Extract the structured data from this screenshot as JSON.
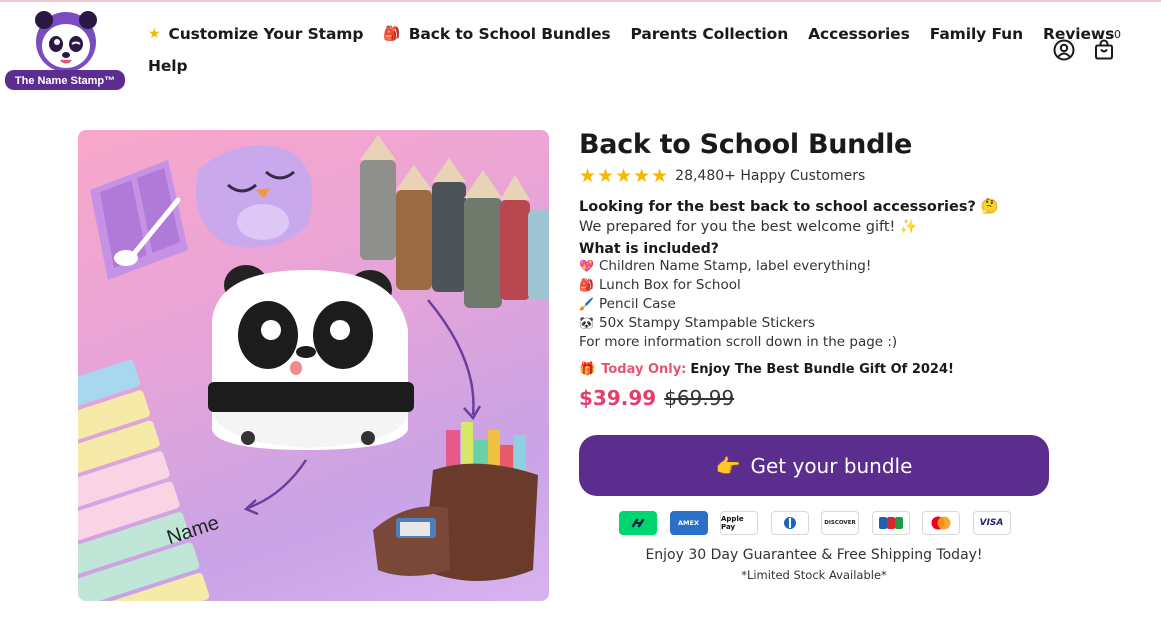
{
  "brand": {
    "logo_text": "The Name Stamp™"
  },
  "nav": {
    "items": [
      {
        "icon": "★",
        "icon_name": "star-icon",
        "label": "Customize Your Stamp"
      },
      {
        "icon": "🎒",
        "icon_name": "backpack-icon",
        "label": "Back to School Bundles"
      },
      {
        "label": "Parents Collection"
      },
      {
        "label": "Accessories"
      },
      {
        "label": "Family Fun"
      },
      {
        "label": "Reviews"
      }
    ],
    "help": "Help"
  },
  "header": {
    "cart_count": "0",
    "account_icon": "account-icon",
    "cart_icon": "shopping-bag-icon"
  },
  "product": {
    "title": "Back to School Bundle",
    "stars": "★★★★★",
    "rating_text": "28,480+ Happy Customers",
    "question": "Looking for the best back to school accessories? 🤔",
    "subtitle": "We prepared for you the best welcome gift! ✨",
    "included_title": "What is included?",
    "included": [
      {
        "emoji": "💖",
        "text": "Children Name Stamp, label everything!"
      },
      {
        "emoji": "🎒",
        "text": "Lunch Box for School"
      },
      {
        "emoji": "🖌️",
        "text": "Pencil Case"
      },
      {
        "emoji": "🐼",
        "text": "50x Stampy Stampable Stickers"
      }
    ],
    "more_info": "For more information scroll down in the page :)",
    "offer_emoji": "🎁",
    "offer_red": "Today Only:",
    "offer_text": "Enjoy The Best Bundle Gift Of 2024!",
    "price": "$39.99",
    "compare_price": "$69.99",
    "cta_emoji": "👉",
    "cta_label": "Get your bundle",
    "payments": [
      "Link",
      "AMEX",
      "Apple Pay",
      "Diners",
      "DISCOVER",
      "JCB",
      "Mastercard",
      "VISA"
    ],
    "guarantee": "Enjoy 30 Day Guarantee & Free Shipping Today!",
    "limited": "*Limited Stock Available*",
    "image_label": "Name"
  },
  "colors": {
    "accent": "#5b2d8e",
    "price": "#e23f6d",
    "offer": "#e8546e",
    "stars": "#f5b800"
  }
}
